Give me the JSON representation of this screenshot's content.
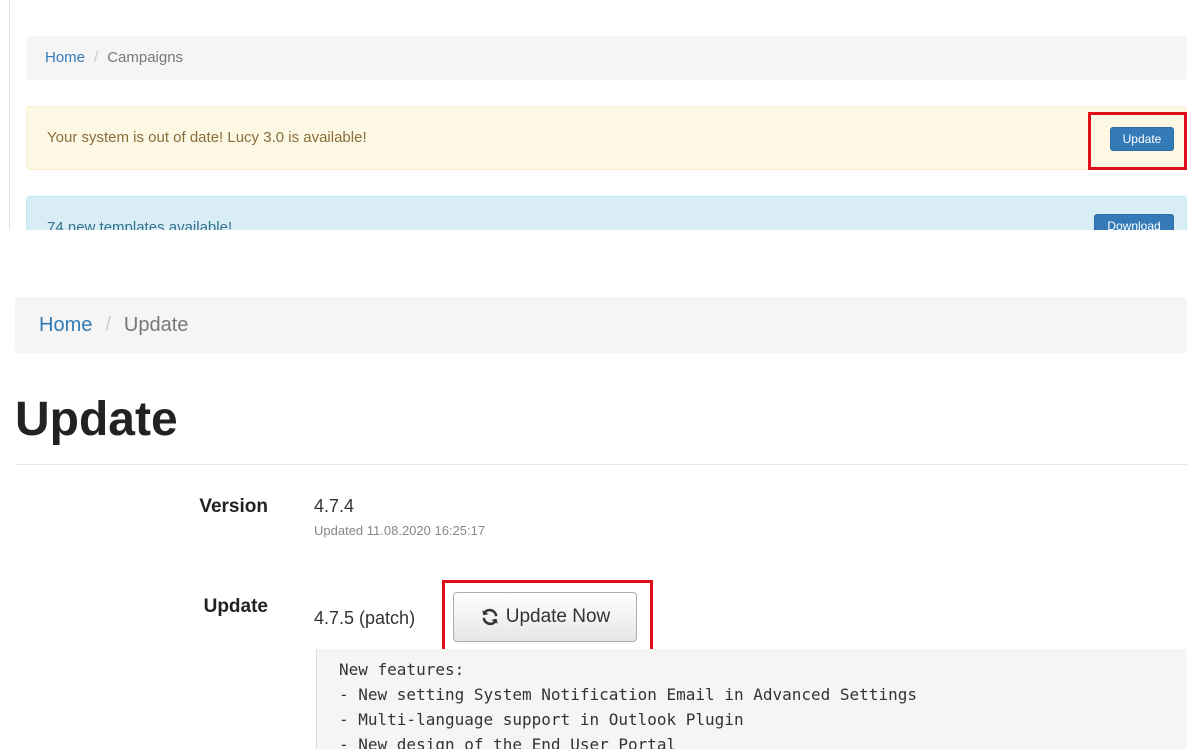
{
  "top": {
    "breadcrumb": {
      "home": "Home",
      "separator": "/",
      "current": "Campaigns"
    },
    "warning_alert": {
      "text": "Your system is out of date! Lucy 3.0 is available!",
      "button_label": "Update"
    },
    "info_alert": {
      "text": "74 new templates available!",
      "button_label": "Download"
    }
  },
  "bottom": {
    "breadcrumb": {
      "home": "Home",
      "separator": "/",
      "current": "Update"
    },
    "page_title": "Update",
    "version": {
      "label": "Version",
      "value": "4.7.4",
      "updated": "Updated 11.08.2020 16:25:17"
    },
    "update": {
      "label": "Update",
      "available": "4.7.5 (patch)",
      "button_label": "Update Now",
      "button_icon": "refresh-icon"
    },
    "changelog": [
      "New features:",
      "- New setting System Notification Email in Advanced Settings",
      "- Multi-language support in Outlook Plugin",
      "- New design of the End User Portal"
    ]
  },
  "colors": {
    "link": "#337ab7",
    "warning_bg": "#fcf8e3",
    "info_bg": "#d9edf7",
    "highlight": "#e0101a"
  }
}
